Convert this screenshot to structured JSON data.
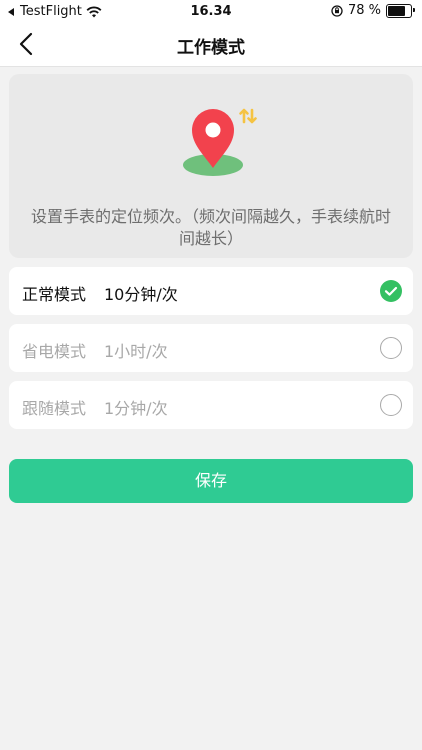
{
  "status_bar": {
    "carrier": "TestFlight",
    "time": "16.34",
    "battery_percent_text": "78 %",
    "battery_level": 0.78,
    "icons": [
      "back-triangle-icon",
      "wifi-icon",
      "orientation-lock-icon",
      "battery-icon"
    ]
  },
  "nav": {
    "title": "工作模式",
    "back_icon": "chevron-left-icon"
  },
  "hero": {
    "icon": "location-pin-sync-icon",
    "description": "设置手表的定位频次。（频次间隔越久，手表续航时间越长）"
  },
  "options": [
    {
      "name": "正常模式",
      "value": "10分钟/次",
      "selected": true
    },
    {
      "name": "省电模式",
      "value": "1小时/次",
      "selected": false
    },
    {
      "name": "跟随模式",
      "value": "1分钟/次",
      "selected": false
    }
  ],
  "save_button": {
    "label": "保存"
  },
  "colors": {
    "accent": "#2fcb93",
    "check": "#34c062",
    "pin": "#f2424d",
    "ground": "#6fc07c",
    "sync_badge": "#f5c342"
  }
}
